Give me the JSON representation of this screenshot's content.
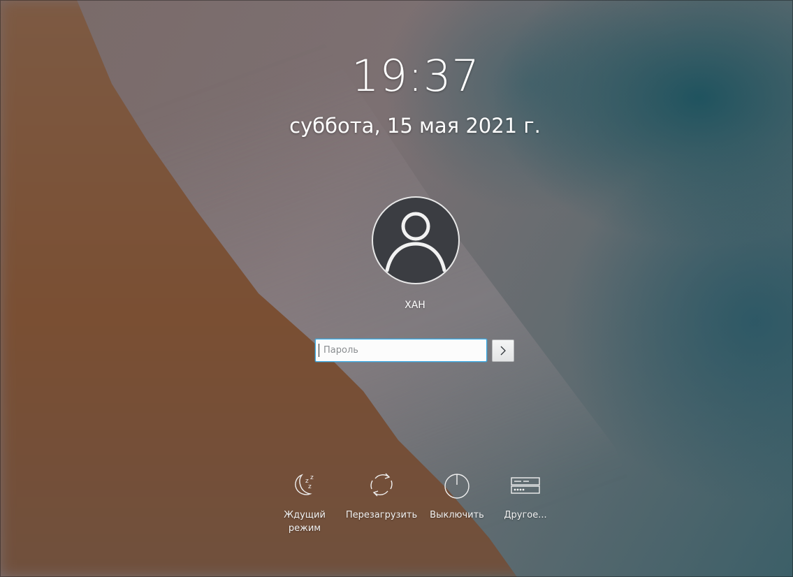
{
  "lockscreen": {
    "time": "19:37",
    "date": "суббота, 15 мая 2021 г.",
    "username": "ХАН",
    "password": {
      "placeholder": "Пароль",
      "value": ""
    }
  },
  "actions": [
    {
      "label": "Ждущий режим",
      "icon": "sleep-moon-icon"
    },
    {
      "label": "Перезагрузить",
      "icon": "restart-icon"
    },
    {
      "label": "Выключить",
      "icon": "power-icon"
    },
    {
      "label": "Другое...",
      "icon": "switch-user-icon"
    }
  ],
  "colors": {
    "accent": "#3daee9",
    "avatar_bg": "#3b3d42"
  }
}
